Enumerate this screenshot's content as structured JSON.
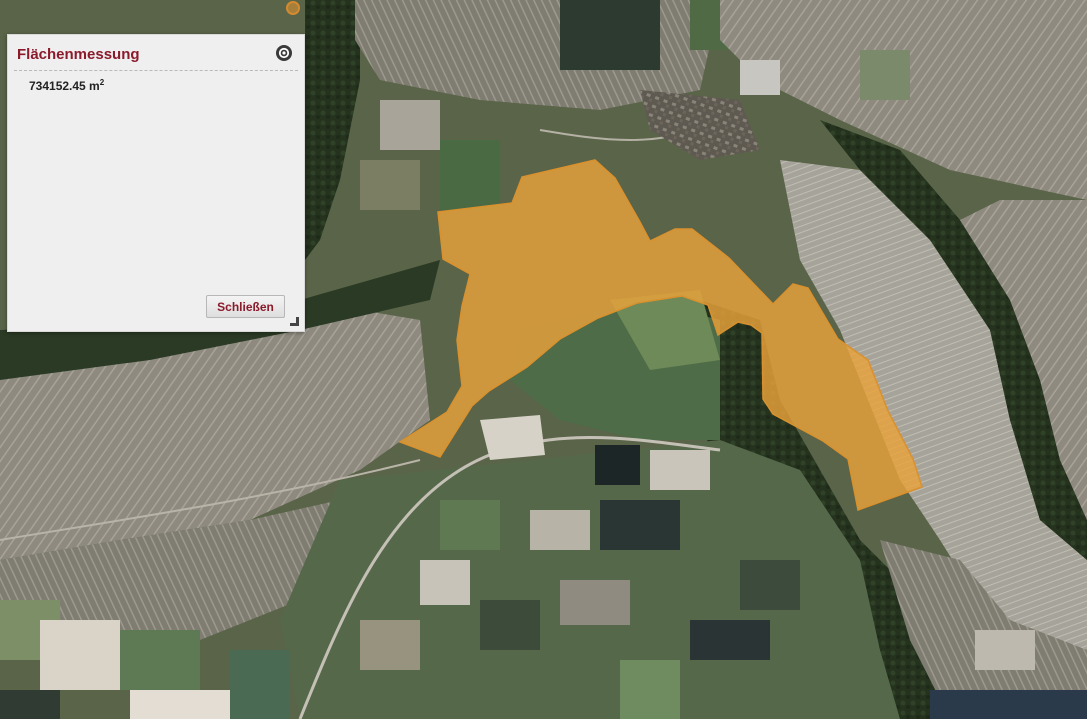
{
  "panel": {
    "title": "Flächenmessung",
    "measurement_value": "734152.45 m",
    "measurement_unit_exponent": "2",
    "close_button_label": "Schließen",
    "close_icon": "close-circle-icon",
    "resize_icon": "resize-corner-icon"
  },
  "map": {
    "background": "aerial-orthophoto",
    "polygon_fill_color": "#e9a23b",
    "polygon_stroke_color": "#d9912e",
    "marker_color": "#d48a2e"
  }
}
